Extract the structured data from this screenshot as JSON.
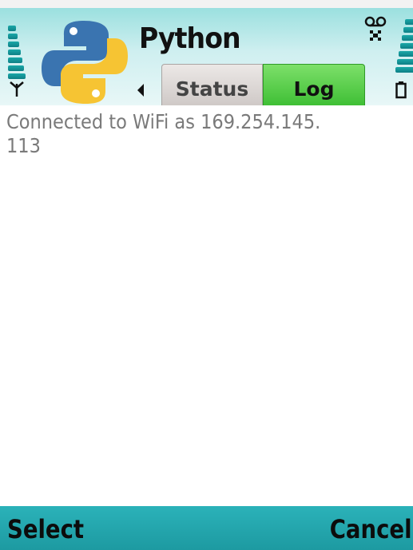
{
  "header": {
    "app_title": "Python",
    "logo_icon": "python-logo-icon",
    "signal_icon": "signal-strength-icon",
    "battery_icon": "battery-level-icon",
    "indicator_icon": "voicemail-indicator-icon"
  },
  "tabs": [
    {
      "label": "Status",
      "selected": false
    },
    {
      "label": "Log",
      "selected": true
    }
  ],
  "log": {
    "text": "Connected to WiFi as 169.254.145.\n113"
  },
  "softkeys": {
    "left": "Select",
    "right": "Cancel"
  },
  "colors": {
    "title_bar": "#bfe9ea",
    "active_tab": "#4cc93f",
    "inactive_tab": "#dcd6d4",
    "softkey_bar": "#22a6ad",
    "log_text": "#7a7a7a"
  }
}
